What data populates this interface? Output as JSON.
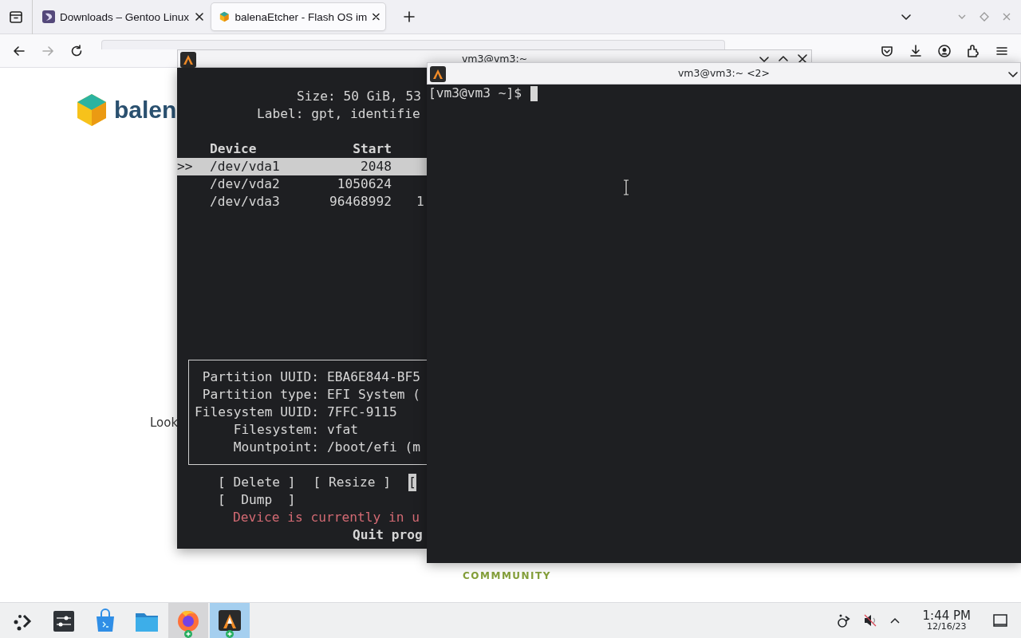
{
  "browser": {
    "tabs": [
      {
        "kind": "gentoo",
        "title": "Downloads – Gentoo Linux",
        "selected": false
      },
      {
        "kind": "balena",
        "title": "balenaEtcher - Flash OS im",
        "selected": true
      }
    ],
    "forward_disabled": true,
    "page": {
      "brand": "balen",
      "link_text": "Look",
      "section_label": "COMMMUNITY"
    }
  },
  "windows": [
    {
      "kind": "cfdisk",
      "title": "vm3@vm3:~",
      "header_lines": [
        "Size: 50 GiB, 53",
        "Label: gpt, identifie"
      ],
      "columns": [
        "Device",
        "Start"
      ],
      "rows": [
        {
          "marker": ">>",
          "device": "/dev/vda1",
          "start": "2048",
          "selected": true
        },
        {
          "device": "/dev/vda2",
          "start": "1050624",
          "selected": false
        },
        {
          "device": "/dev/vda3",
          "start": "96468992",
          "column_3": "1",
          "selected": false
        }
      ],
      "details": [
        {
          "label": "Partition UUID:",
          "value": "EBA6E844-BF5"
        },
        {
          "label": "Partition type:",
          "value": "EFI System ("
        },
        {
          "label": "Filesystem UUID:",
          "value": "7FFC-9115"
        },
        {
          "label": "Filesystem:",
          "value": "vfat"
        },
        {
          "label": "Mountpoint:",
          "value": "/boot/efi (m"
        }
      ],
      "action_rows": [
        [
          {
            "label": "[ Delete ]",
            "selected": false
          },
          {
            "label": "[ Resize ]",
            "selected": false
          },
          {
            "label": "[",
            "selected": true
          }
        ],
        [
          {
            "label": "[  Dump  ]",
            "selected": false
          }
        ]
      ],
      "warning": "Device is currently in u",
      "hint": "Quit prog"
    },
    {
      "kind": "shell",
      "title": "vm3@vm3:~ <2>",
      "prompt": "[vm3@vm3 ~]$"
    }
  ],
  "taskbar": {
    "apps": [
      {
        "kind": "launcher",
        "selected": false,
        "hovered": false,
        "running": false
      },
      {
        "kind": "settings",
        "selected": false,
        "hovered": false,
        "running": false
      },
      {
        "kind": "store",
        "selected": false,
        "hovered": false,
        "running": false
      },
      {
        "kind": "files",
        "selected": false,
        "hovered": false,
        "running": false
      },
      {
        "kind": "firefox",
        "selected": false,
        "hovered": true,
        "running": true
      },
      {
        "kind": "terminal",
        "selected": true,
        "hovered": false,
        "running": true
      }
    ],
    "clock": {
      "time": "1:44 PM",
      "date": "12/16/23"
    }
  }
}
